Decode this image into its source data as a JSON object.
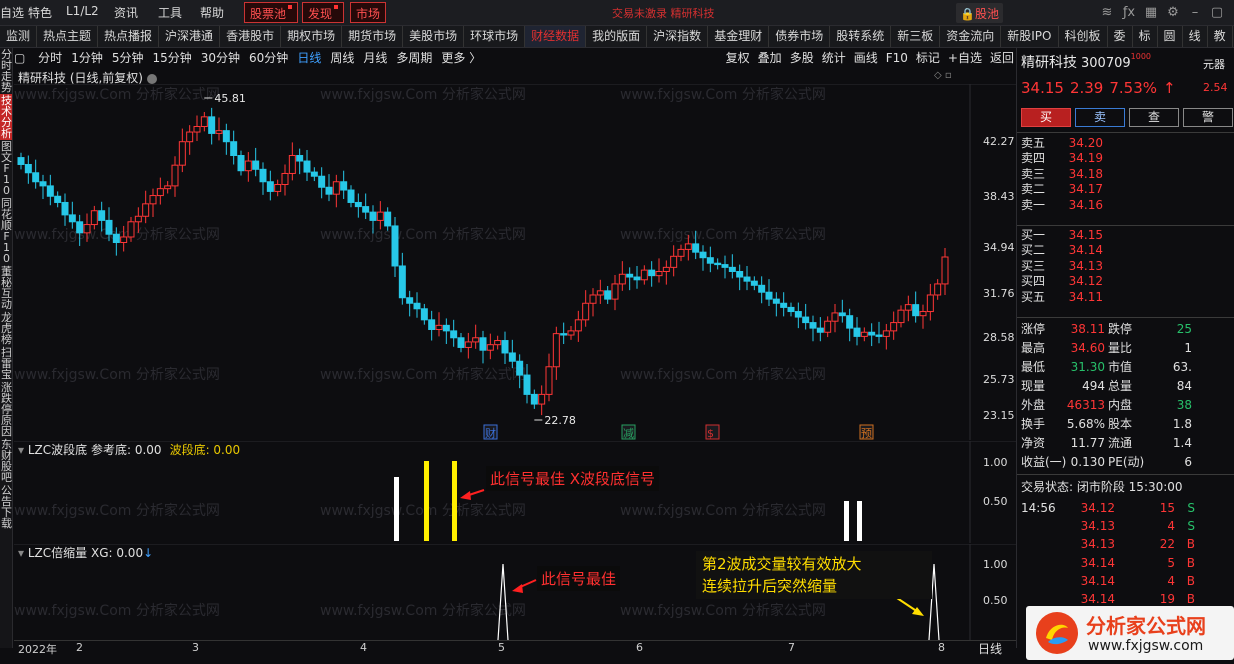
{
  "topbar": {
    "items": [
      "自选",
      "特色",
      "L1/L2",
      "资讯",
      "工具",
      "帮助"
    ],
    "pool_btn": "股票池",
    "find_btn": "发现",
    "market_btn": "市场",
    "ticker": "交易未激录  精研科技",
    "stock_pool": "股池"
  },
  "navbar": {
    "items": [
      "监测",
      "热点主题",
      "热点播报",
      "沪深港通",
      "香港股市",
      "期权市场",
      "期货市场",
      "美股市场",
      "环球市场",
      "财经数据",
      "我的版面",
      "沪深指数",
      "基金理财",
      "债券市场",
      "股转系统",
      "新三板",
      "资金流向",
      "新股IPO",
      "科创板",
      "委",
      "标",
      "圆",
      "线",
      "教"
    ],
    "active_index": 9
  },
  "toolbar": {
    "periods": [
      "分时",
      "1分钟",
      "5分钟",
      "15分钟",
      "30分钟",
      "60分钟",
      "日线",
      "周线",
      "月线",
      "多周期",
      "更多 〉"
    ],
    "active_index": 6,
    "right": [
      "复权",
      "叠加",
      "多股",
      "统计",
      "画线",
      "F10",
      "标记",
      "+自选",
      "返回"
    ]
  },
  "left_tabs": [
    "分时走势",
    "技术分析",
    "图文F10",
    "同花顺F10",
    "董秘互动",
    "龙虎榜",
    "扫雷宝",
    "涨跌停原因",
    "东财股吧",
    "公告下载"
  ],
  "left_active": 1,
  "chart": {
    "title": "精研科技 (日线,前复权)",
    "price_labels": [
      "42.27",
      "38.43",
      "34.94",
      "31.76",
      "28.58",
      "25.73",
      "23.15"
    ],
    "high_label": "45.81",
    "low_label": "22.78",
    "event_markers": [
      "财",
      "减",
      "$",
      "预"
    ]
  },
  "indicator1": {
    "name": "LZC波段底",
    "ref_text": "参考底: 0.00",
    "wave_text": "波段底: 0.00",
    "labels": [
      "1.00",
      "0.50"
    ]
  },
  "indicator2": {
    "name": "LZC倍缩量",
    "xg_text": "XG: 0.00",
    "labels": [
      "1.00",
      "0.50"
    ]
  },
  "annotations": {
    "a1": "此信号最佳 ",
    "a1b": "X波段底信号",
    "a2": "此信号最佳",
    "a3_line1": "第2波成交量较有效放大",
    "a3_line2": "连续拉升后突然缩量"
  },
  "date_axis": {
    "labels": [
      "2022年",
      "2",
      "3",
      "4",
      "5",
      "6",
      "7",
      "8"
    ],
    "daily": "日线"
  },
  "watermark": "www.fxjgsw.Com  分析家公式网",
  "quote": {
    "name": "精研科技",
    "code": "300709",
    "code_badge": "1000",
    "side_label": "元器",
    "price": "34.15",
    "change": "2.39",
    "pct": "7.53%",
    "side_val": "2.54",
    "buttons": [
      "买",
      "卖",
      "查",
      "警"
    ]
  },
  "order_book": {
    "asks": [
      {
        "label": "卖五",
        "price": "34.20",
        "vol": ""
      },
      {
        "label": "卖四",
        "price": "34.19",
        "vol": ""
      },
      {
        "label": "卖三",
        "price": "34.18",
        "vol": ""
      },
      {
        "label": "卖二",
        "price": "34.17",
        "vol": ""
      },
      {
        "label": "卖一",
        "price": "34.16",
        "vol": ""
      }
    ],
    "bids": [
      {
        "label": "买一",
        "price": "34.15",
        "vol": ""
      },
      {
        "label": "买二",
        "price": "34.14",
        "vol": ""
      },
      {
        "label": "买三",
        "price": "34.13",
        "vol": ""
      },
      {
        "label": "买四",
        "price": "34.12",
        "vol": ""
      },
      {
        "label": "买五",
        "price": "34.11",
        "vol": ""
      }
    ]
  },
  "stats": [
    {
      "l1": "涨停",
      "v1": "38.11",
      "c1": "red",
      "l2": "跌停",
      "v2": "25",
      "c2": "green"
    },
    {
      "l1": "最高",
      "v1": "34.60",
      "c1": "red",
      "l2": "量比",
      "v2": "1",
      "c2": "white"
    },
    {
      "l1": "最低",
      "v1": "31.30",
      "c1": "green",
      "l2": "市值",
      "v2": "63.",
      "c2": "white"
    },
    {
      "l1": "现量",
      "v1": "494",
      "c1": "white",
      "l2": "总量",
      "v2": "84",
      "c2": "white"
    },
    {
      "l1": "外盘",
      "v1": "46313",
      "c1": "red",
      "l2": "内盘",
      "v2": "38",
      "c2": "green"
    },
    {
      "l1": "换手",
      "v1": "5.68%",
      "c1": "white",
      "l2": "股本",
      "v2": "1.8",
      "c2": "white"
    },
    {
      "l1": "净资",
      "v1": "11.77",
      "c1": "white",
      "l2": "流通",
      "v2": "1.4",
      "c2": "white"
    },
    {
      "l1": "收益(一)",
      "v1": "0.130",
      "c1": "white",
      "l2": "PE(动)",
      "v2": "6",
      "c2": "white"
    }
  ],
  "trade_status": "交易状态: 闭市阶段 15:30:00",
  "ticks": [
    {
      "t": "14:56",
      "p": "34.12",
      "v": "15",
      "s": "S"
    },
    {
      "t": "",
      "p": "34.13",
      "v": "4",
      "s": "S"
    },
    {
      "t": "",
      "p": "34.13",
      "v": "22",
      "s": "B"
    },
    {
      "t": "",
      "p": "34.14",
      "v": "5",
      "s": "B"
    },
    {
      "t": "",
      "p": "34.14",
      "v": "4",
      "s": "B"
    },
    {
      "t": "",
      "p": "34.14",
      "v": "19",
      "s": "B"
    },
    {
      "t": "",
      "p": "",
      "v": "",
      "s": ""
    }
  ],
  "logo": {
    "title": "分析家公式网",
    "url": "www.fxjgsw.com"
  },
  "colors": {
    "up": "#ff3636",
    "down": "#27c8e8",
    "accent_red": "#e03030",
    "signal_yellow": "#ffee00",
    "signal_white": "#ffffff"
  },
  "chart_data": {
    "type": "candlestick",
    "title": "精研科技 (日线,前复权)",
    "y_range": [
      22.78,
      45.81
    ],
    "x_labels": [
      "2022年",
      "2",
      "3",
      "4",
      "5",
      "6",
      "7",
      "8"
    ],
    "closes": [
      40.85,
      40.25,
      39.6,
      39.3,
      38.55,
      38.1,
      37.2,
      36.7,
      35.9,
      36.5,
      37.5,
      36.8,
      35.8,
      35.2,
      35.6,
      36.7,
      37.1,
      38.0,
      38.6,
      39.1,
      39.3,
      40.8,
      42.5,
      43.2,
      43.6,
      44.3,
      43.1,
      43.3,
      42.5,
      41.5,
      40.4,
      41.1,
      40.5,
      39.6,
      38.9,
      39.4,
      40.2,
      41.5,
      41.1,
      40.3,
      40.0,
      39.2,
      38.7,
      39.6,
      39.0,
      38.1,
      37.8,
      37.4,
      36.8,
      37.4,
      36.4,
      33.5,
      31.2,
      30.8,
      30.4,
      29.6,
      28.9,
      29.2,
      28.8,
      28.3,
      27.6,
      28.0,
      28.3,
      27.4,
      27.8,
      28.1,
      27.2,
      26.6,
      25.6,
      24.2,
      23.5,
      24.2,
      26.2,
      28.6,
      28.5,
      28.8,
      29.6,
      30.8,
      31.4,
      31.7,
      31.1,
      32.2,
      32.9,
      32.7,
      32.5,
      33.2,
      32.8,
      33.1,
      33.4,
      34.2,
      34.7,
      35.1,
      34.5,
      34.1,
      33.7,
      33.6,
      33.4,
      33.1,
      32.7,
      32.4,
      32.1,
      31.6,
      31.1,
      30.8,
      30.5,
      30.2,
      29.8,
      29.4,
      29.0,
      28.7,
      29.5,
      30.1,
      29.9,
      29.0,
      28.4,
      28.7,
      28.5,
      28.4,
      28.8,
      29.4,
      30.3,
      30.7,
      29.9,
      30.2,
      31.4,
      32.2,
      34.15
    ],
    "signal_bars_LZC_bottom": [
      {
        "x_index": 93,
        "value": 0.8,
        "color": "white"
      },
      {
        "x_index": 99,
        "value": 1.0,
        "color": "yellow"
      },
      {
        "x_index": 106,
        "value": 1.0,
        "color": "yellow"
      },
      {
        "x_index": 199,
        "value": 0.5,
        "color": "white"
      },
      {
        "x_index": 202,
        "value": 0.5,
        "color": "white"
      }
    ],
    "signal_LZC_volume": [
      {
        "x_label": "5",
        "value": 1.0
      },
      {
        "x_label": "8",
        "value": 1.0
      }
    ]
  }
}
